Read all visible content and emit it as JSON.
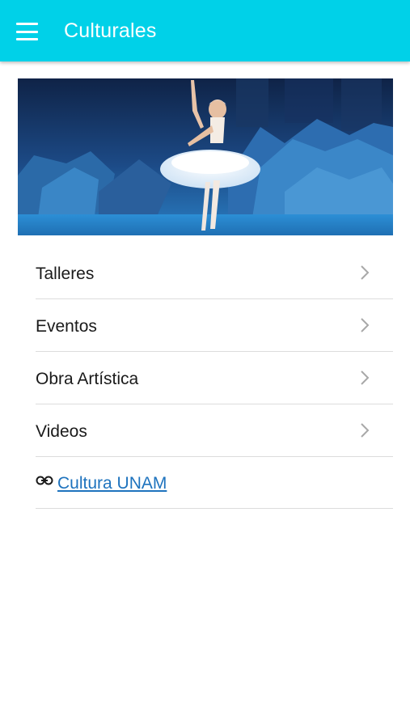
{
  "appbar": {
    "title": "Culturales",
    "menu_icon": "hamburger-menu-icon",
    "color": "#00d1e8"
  },
  "hero": {
    "image": "ballet-dancer-photo"
  },
  "menu": {
    "items": [
      {
        "label": "Talleres",
        "icon": "chevron-right-icon"
      },
      {
        "label": "Eventos",
        "icon": "chevron-right-icon"
      },
      {
        "label": "Obra Artística",
        "icon": "chevron-right-icon"
      },
      {
        "label": "Videos",
        "icon": "chevron-right-icon"
      }
    ],
    "link": {
      "label": "Cultura UNAM",
      "icon": "link-icon",
      "color": "#1e73be"
    }
  }
}
